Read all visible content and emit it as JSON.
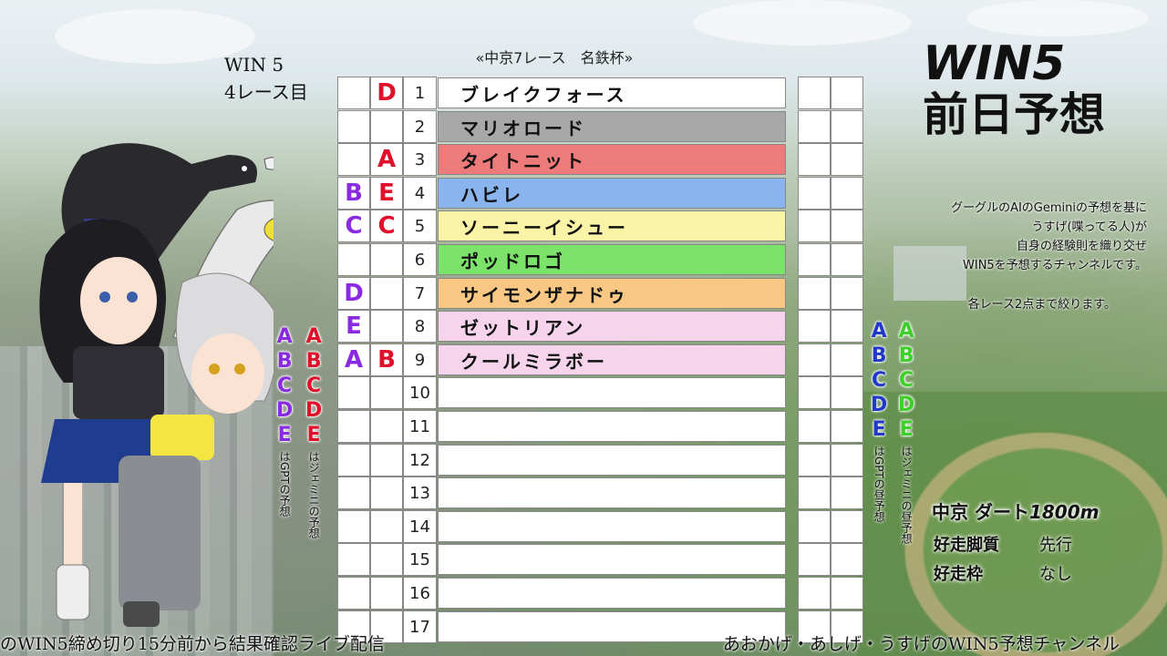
{
  "race_info": {
    "win5": "WIN 5",
    "leg": "4レース目",
    "race_title": "«中京7レース　名鉄杯»"
  },
  "headline": {
    "line1": "WIN5",
    "line2": "前日予想"
  },
  "description": [
    "グーグルのAIのGeminiの予想を基に",
    "うすげ(喋ってる人)が",
    "自身の経験則を織り交ぜ",
    "WIN5を予想するチャンネルです。"
  ],
  "description2": "各レース2点まで絞ります。",
  "colors": {
    "mark_red": "#e0102a",
    "mark_purple": "#8a2be2",
    "mark_blue": "#2238c8",
    "mark_green": "#3fcf2a",
    "row_gray": "#a8a8a8",
    "row_red": "#ee7b7b",
    "row_blue": "#8ab4ee",
    "row_yellow": "#fbf3a6",
    "row_green": "#7be36a",
    "row_orange": "#f7c783",
    "row_pink": "#f6d4ec"
  },
  "horses": [
    {
      "num": "1",
      "name": "ブレイクフォース",
      "color": "#ffffff",
      "mark_left": "",
      "mark_right": "D"
    },
    {
      "num": "2",
      "name": "マリオロード",
      "color": "#a8a8a8",
      "mark_left": "",
      "mark_right": ""
    },
    {
      "num": "3",
      "name": "タイトニット",
      "color": "#ee7b7b",
      "mark_left": "",
      "mark_right": "A"
    },
    {
      "num": "4",
      "name": "ハビレ",
      "color": "#8ab4ee",
      "mark_left": "B",
      "mark_right": "E"
    },
    {
      "num": "5",
      "name": "ソーニーイシュー",
      "color": "#fbf3a6",
      "mark_left": "C",
      "mark_right": "C"
    },
    {
      "num": "6",
      "name": "ポッドロゴ",
      "color": "#7be36a",
      "mark_left": "",
      "mark_right": ""
    },
    {
      "num": "7",
      "name": "サイモンザナドゥ",
      "color": "#f7c783",
      "mark_left": "D",
      "mark_right": ""
    },
    {
      "num": "8",
      "name": "ゼットリアン",
      "color": "#f6d4ec",
      "mark_left": "E",
      "mark_right": ""
    },
    {
      "num": "9",
      "name": "クールミラボー",
      "color": "#f6d4ec",
      "mark_left": "A",
      "mark_right": "B"
    },
    {
      "num": "10",
      "name": "",
      "color": "#ffffff",
      "mark_left": "",
      "mark_right": ""
    },
    {
      "num": "11",
      "name": "",
      "color": "#ffffff",
      "mark_left": "",
      "mark_right": ""
    },
    {
      "num": "12",
      "name": "",
      "color": "#ffffff",
      "mark_left": "",
      "mark_right": ""
    },
    {
      "num": "13",
      "name": "",
      "color": "#ffffff",
      "mark_left": "",
      "mark_right": ""
    },
    {
      "num": "14",
      "name": "",
      "color": "#ffffff",
      "mark_left": "",
      "mark_right": ""
    },
    {
      "num": "15",
      "name": "",
      "color": "#ffffff",
      "mark_left": "",
      "mark_right": ""
    },
    {
      "num": "16",
      "name": "",
      "color": "#ffffff",
      "mark_left": "",
      "mark_right": ""
    },
    {
      "num": "17",
      "name": "",
      "color": "#ffffff",
      "mark_left": "",
      "mark_right": ""
    }
  ],
  "legend": {
    "letters": [
      "A",
      "B",
      "C",
      "D",
      "E"
    ],
    "gpt_note": "はGPTの予想",
    "gemini_note": "はジェミニの予想",
    "gpt_noon_note": "はGPTの昼予想",
    "gemini_noon_note": "はジェミニの昼予想"
  },
  "course": {
    "place": "中京",
    "surface": "ダート",
    "distance": "1800m",
    "style_label": "好走脚質",
    "style_value": "先行",
    "gate_label": "好走枠",
    "gate_value": "なし"
  },
  "footer": {
    "left": "のWIN5締め切り15分前から結果確認ライブ配信",
    "right": "あおかげ・あしげ・うすげのWIN5予想チャンネル"
  },
  "icons": [
    "racehorse-black-icon",
    "racehorse-white-icon",
    "girl-black-hair-icon",
    "girl-white-hair-icon"
  ]
}
